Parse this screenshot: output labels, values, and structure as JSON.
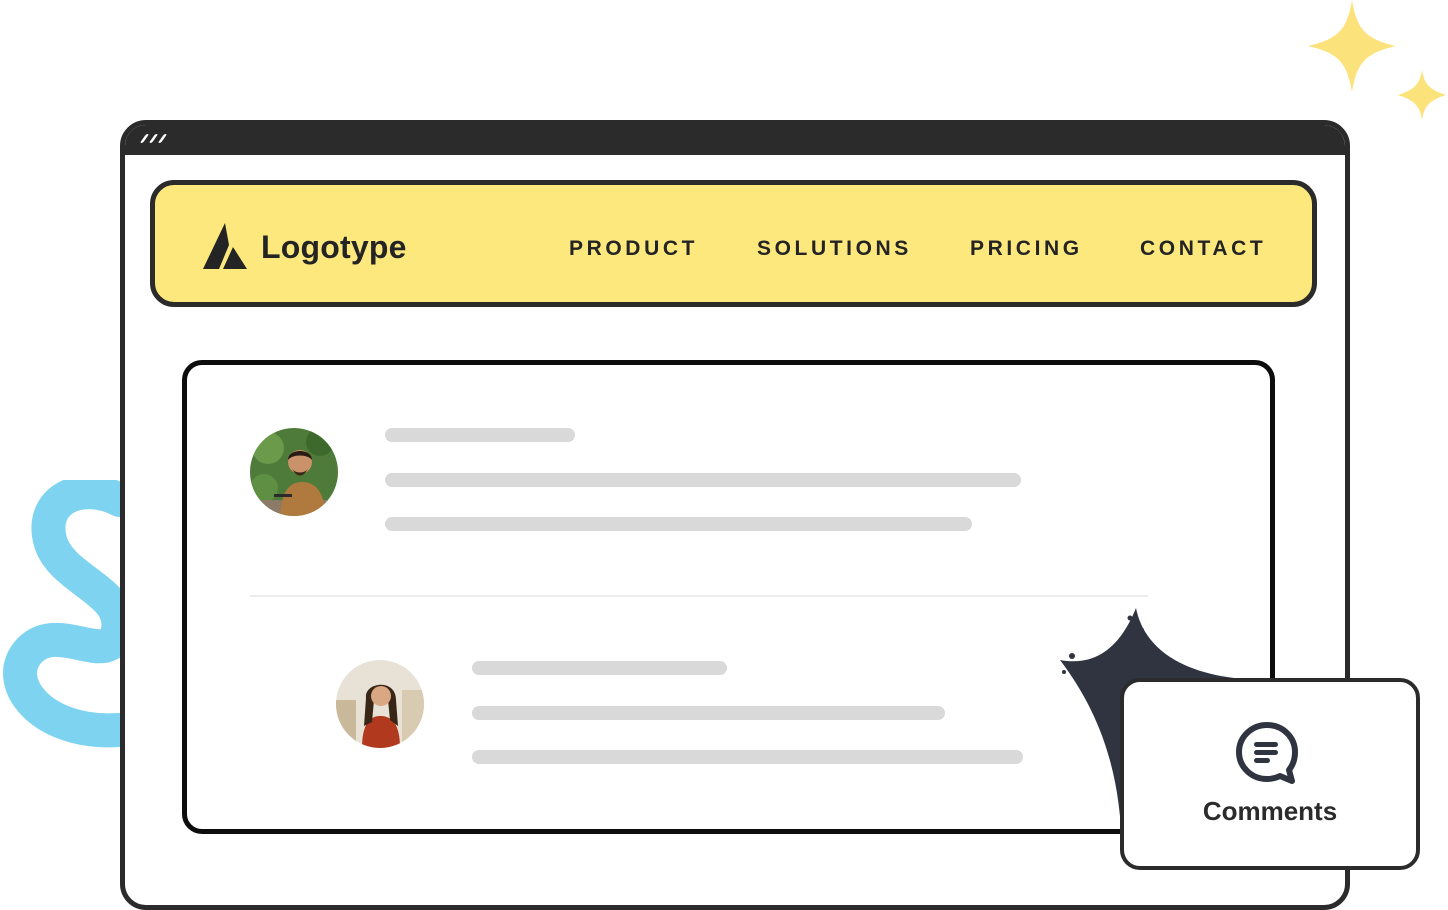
{
  "navbar": {
    "logo_text": "Logotype",
    "items": [
      {
        "label": "PRODUCT"
      },
      {
        "label": "SOLUTIONS"
      },
      {
        "label": "PRICING"
      },
      {
        "label": "CONTACT"
      }
    ]
  },
  "comments_widget": {
    "label": "Comments",
    "icon": "comments-icon"
  },
  "colors": {
    "navbar_bg": "#fde87e",
    "frame": "#2b2b2b",
    "sparkle": "#fbe27a",
    "squiggle": "#7dd3f0",
    "placeholder_line": "#d9d9d9"
  }
}
